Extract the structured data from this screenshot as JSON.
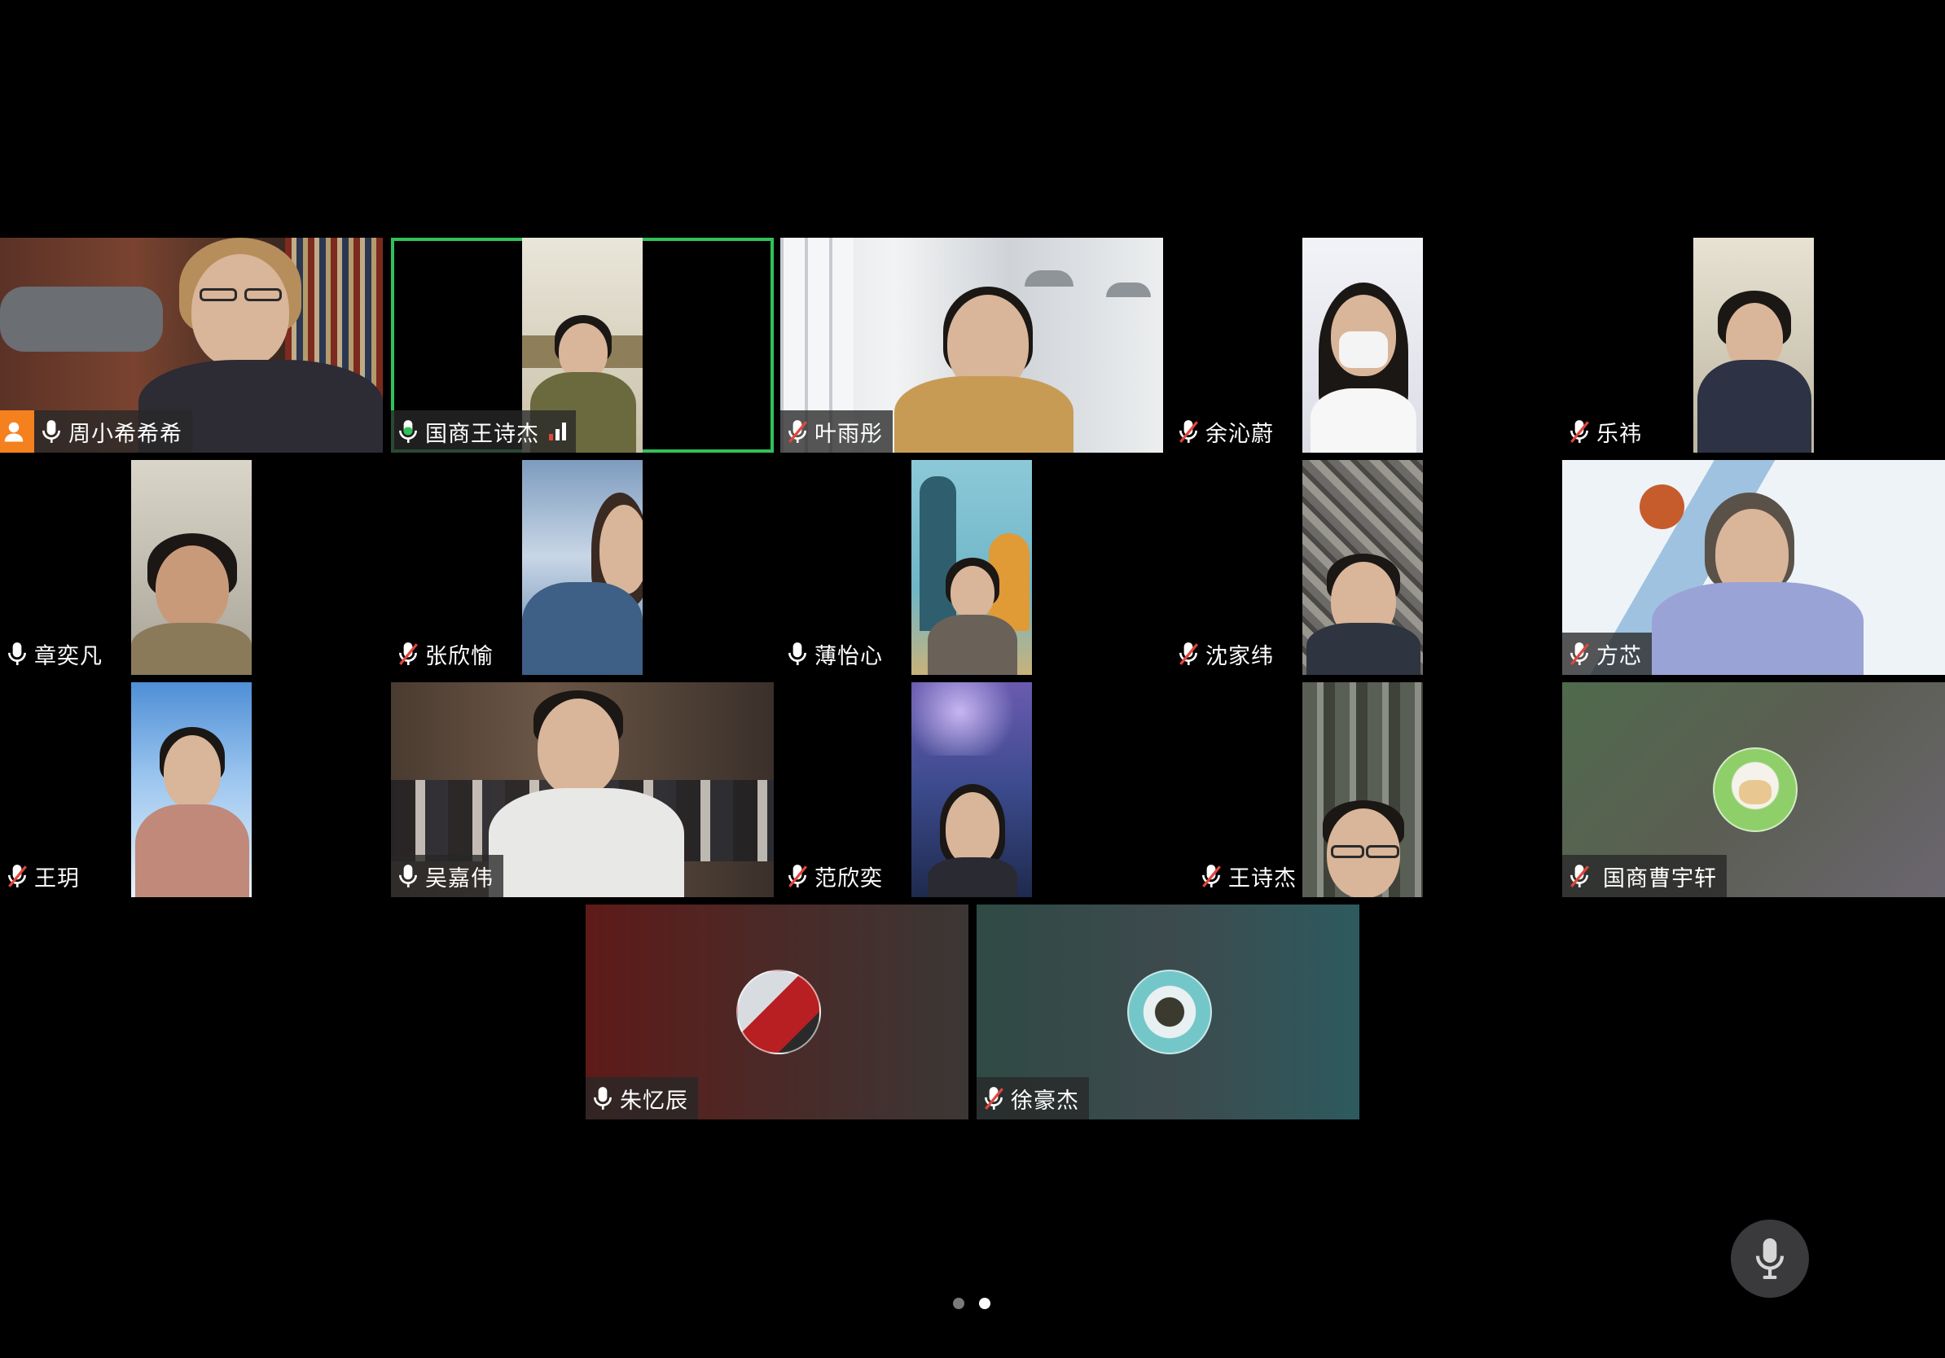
{
  "participants": [
    {
      "name": "周小希希希",
      "mic": "on",
      "host": true
    },
    {
      "name": "国商王诗杰",
      "mic": "on",
      "active": true,
      "signal": true
    },
    {
      "name": "叶雨彤",
      "mic": "muted"
    },
    {
      "name": "余沁蔚",
      "mic": "muted"
    },
    {
      "name": "乐祎",
      "mic": "muted"
    },
    {
      "name": "章奕凡",
      "mic": "on"
    },
    {
      "name": "张欣愉",
      "mic": "muted"
    },
    {
      "name": "薄怡心",
      "mic": "on"
    },
    {
      "name": "沈家纬",
      "mic": "muted"
    },
    {
      "name": "方芯",
      "mic": "muted"
    },
    {
      "name": "王玥",
      "mic": "muted"
    },
    {
      "name": "吴嘉伟",
      "mic": "on"
    },
    {
      "name": "范欣奕",
      "mic": "muted"
    },
    {
      "name": "王诗杰",
      "mic": "muted"
    },
    {
      "name": "国商曹宇轩",
      "mic": "muted"
    },
    {
      "name": "朱忆辰",
      "mic": "on"
    },
    {
      "name": "徐豪杰",
      "mic": "muted"
    }
  ],
  "icons": {
    "mic_on": "microphone-icon",
    "mic_muted": "microphone-muted-icon",
    "host": "host-person-icon",
    "signal": "signal-strength-icon"
  },
  "pager": {
    "pages": 2,
    "current": 2
  },
  "colors": {
    "active_border": "#31c15a",
    "host_badge": "#f5801e",
    "background": "#000000"
  }
}
